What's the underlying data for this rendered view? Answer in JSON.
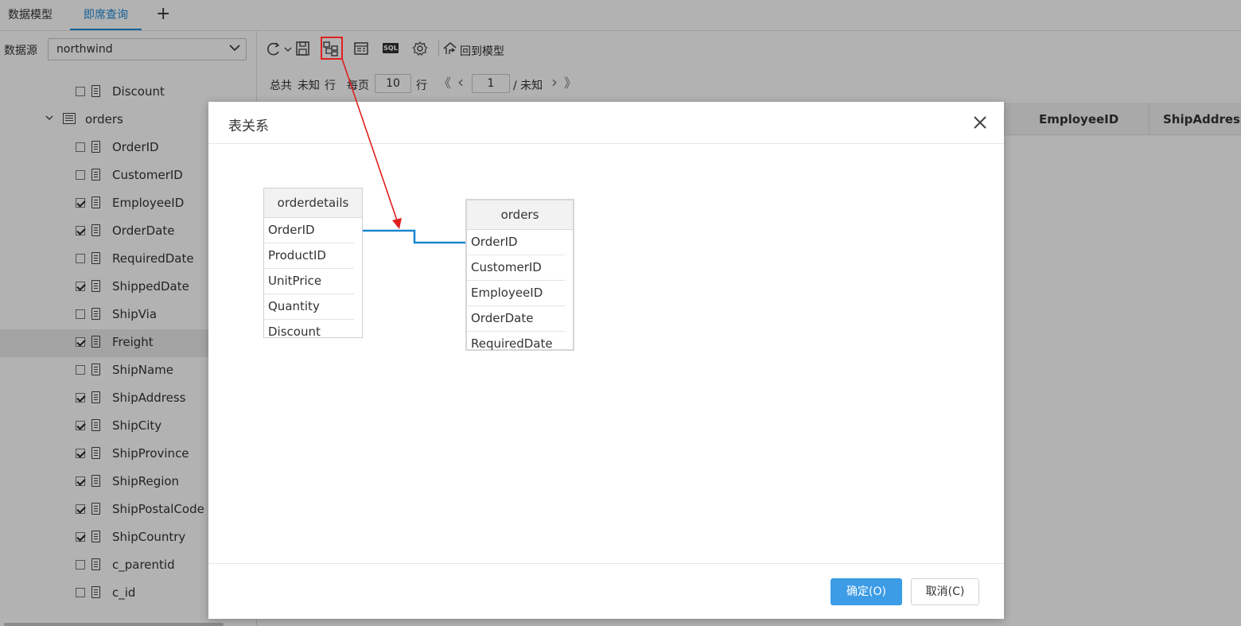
{
  "tabs": {
    "items": [
      {
        "label": "数据模型",
        "active": false
      },
      {
        "label": "即席查询",
        "active": true
      }
    ],
    "add_label": "+"
  },
  "datasource": {
    "label": "数据源",
    "value": "northwind"
  },
  "tree": {
    "rows": [
      {
        "type": "field",
        "label": "Discount",
        "checked": false
      },
      {
        "type": "table",
        "label": "orders",
        "expanded": true
      },
      {
        "type": "field",
        "label": "OrderID",
        "checked": false
      },
      {
        "type": "field",
        "label": "CustomerID",
        "checked": false
      },
      {
        "type": "field",
        "label": "EmployeeID",
        "checked": true
      },
      {
        "type": "field",
        "label": "OrderDate",
        "checked": true
      },
      {
        "type": "field",
        "label": "RequiredDate",
        "checked": false
      },
      {
        "type": "field",
        "label": "ShippedDate",
        "checked": true
      },
      {
        "type": "field",
        "label": "ShipVia",
        "checked": false
      },
      {
        "type": "field",
        "label": "Freight",
        "checked": true,
        "highlighted": true
      },
      {
        "type": "field",
        "label": "ShipName",
        "checked": false
      },
      {
        "type": "field",
        "label": "ShipAddress",
        "checked": true
      },
      {
        "type": "field",
        "label": "ShipCity",
        "checked": true
      },
      {
        "type": "field",
        "label": "ShipProvince",
        "checked": true
      },
      {
        "type": "field",
        "label": "ShipRegion",
        "checked": true
      },
      {
        "type": "field",
        "label": "ShipPostalCode",
        "checked": true
      },
      {
        "type": "field",
        "label": "ShipCountry",
        "checked": true
      },
      {
        "type": "field",
        "label": "c_parentid",
        "checked": false
      },
      {
        "type": "field",
        "label": "c_id",
        "checked": false
      }
    ]
  },
  "toolbar": {
    "back_to_model_label": "回到模型",
    "sql_label": "SQL",
    "icons": [
      "refresh-icon",
      "save-icon",
      "table-relation-icon",
      "layout-icon",
      "sql-icon",
      "gear-icon",
      "back-home-icon"
    ]
  },
  "pager": {
    "total_prefix": "总共",
    "total_value": "未知",
    "total_suffix": "行",
    "per_page_label": "每页",
    "per_page_value": "10",
    "per_page_suffix": "行",
    "first_symbol": "《",
    "prev_symbol": "‹",
    "page_value": "1",
    "page_of": "/ 未知",
    "next_symbol": "›",
    "last_symbol": "》"
  },
  "grid": {
    "columns": [
      "EmployeeID",
      "ShipAddress"
    ]
  },
  "dialog": {
    "title": "表关系",
    "ok_label": "确定(O)",
    "cancel_label": "取消(C)",
    "entities": [
      {
        "name": "orderdetails",
        "fields": [
          "OrderID",
          "ProductID",
          "UnitPrice",
          "Quantity",
          "Discount"
        ]
      },
      {
        "name": "orders",
        "fields": [
          "OrderID",
          "CustomerID",
          "EmployeeID",
          "OrderDate",
          "RequiredDate"
        ]
      }
    ]
  },
  "colors": {
    "accent": "#1e8ad6",
    "ok_button": "#3c9ce6",
    "relation_line": "#1a86d0",
    "annotation": "#e02020"
  }
}
